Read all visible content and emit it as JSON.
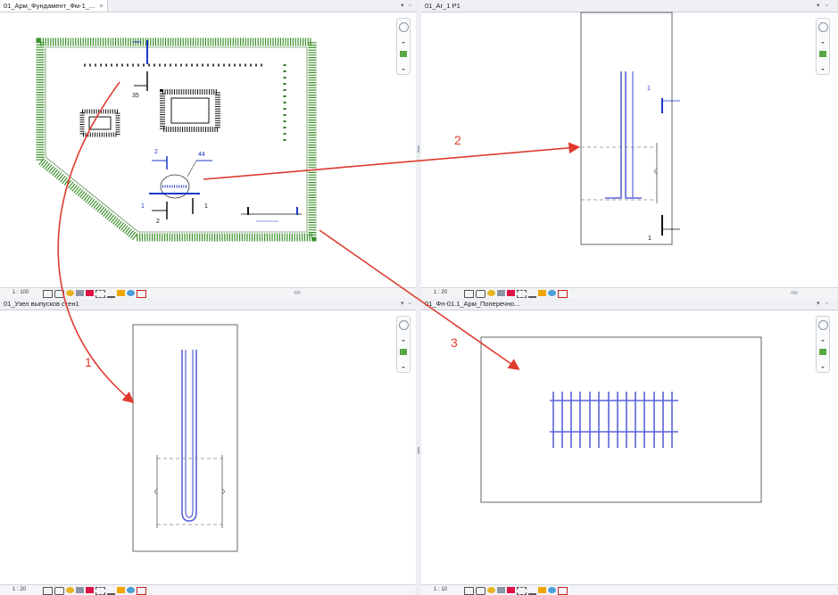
{
  "views": [
    {
      "tab_label": "01_Арм_Фундамент_Фм-1_...",
      "close_glyph": "×",
      "scale": "1 : 100",
      "drawing": {
        "section_marks": [
          "1",
          "1"
        ],
        "elevation_marks": [
          "2",
          "2"
        ],
        "dimension_labels": [
          "35",
          "44"
        ]
      }
    },
    {
      "tab_label": "01_Аг_1 Р1",
      "scale": "1 : 20",
      "drawing": {
        "section_marks": [
          "1",
          "1"
        ]
      }
    },
    {
      "tab_label": "01_Узел выпусков стен1",
      "scale": "1 : 20"
    },
    {
      "tab_label": "01_Фп-01.1_Арм_Поперечно...",
      "scale": "1 : 10"
    }
  ],
  "view_controls": [
    "▾",
    "▫"
  ],
  "callouts": [
    "1",
    "2",
    "3"
  ],
  "colors": {
    "callout_arrow": "#e03a2f",
    "rebar_green": "#3b8f2a",
    "rebar_blue": "#3c46cf",
    "annotation_blue": "#1b38c6",
    "tab_bar": "#eef0f3",
    "status_bar": "#f3f4f6"
  },
  "icons": [
    "full-navigation-wheel-icon",
    "zoom-icon",
    "sun-path-icon",
    "crop-view-icon",
    "detail-level-icon"
  ]
}
